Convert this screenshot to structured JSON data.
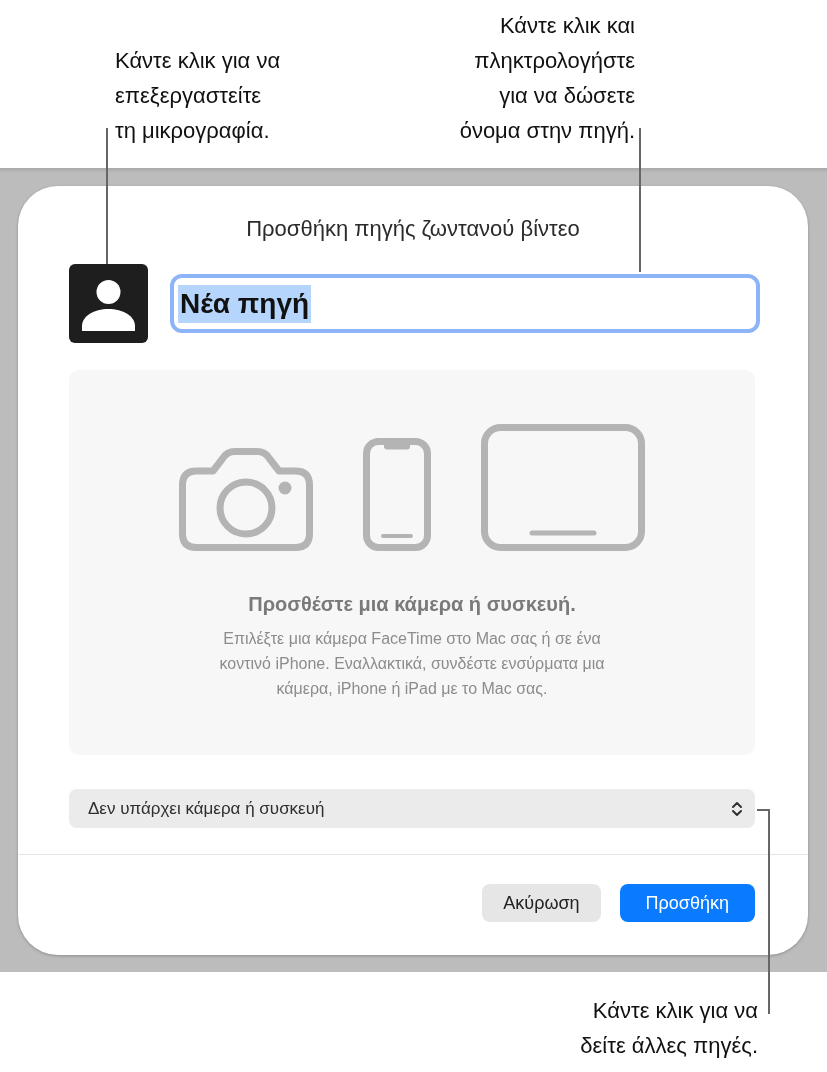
{
  "callouts": [
    {
      "lines": [
        "Κάντε κλικ για να",
        "επεξεργαστείτε",
        "τη μικρογραφία."
      ]
    },
    {
      "lines": [
        "Κάντε κλικ και",
        "πληκτρολογήστε",
        "για να δώσετε",
        "όνομα στην πηγή."
      ]
    },
    {
      "lines": [
        "Κάντε κλικ για να",
        "δείτε άλλες πηγές."
      ]
    }
  ],
  "dialog": {
    "title": "Προσθήκη πηγής ζωντανού βίντεο",
    "name_field": {
      "value": "Νέα πηγή",
      "focused": true,
      "text_selected": true
    },
    "empty_state": {
      "heading": "Προσθέστε μια κάμερα ή συσκευή.",
      "description_lines": [
        "Επιλέξτε μια κάμερα FaceTime στο Mac σας ή σε ένα",
        "κοντινό iPhone. Εναλλακτικά, συνδέστε ενσύρματα μια",
        "κάμερα, iPhone ή iPad με το Mac σας."
      ]
    },
    "source_popup": {
      "value": "Δεν υπάρχει κάμερα ή συσκευή"
    },
    "buttons": [
      {
        "label": "Ακύρωση",
        "kind": "secondary"
      },
      {
        "label": "Προσθήκη",
        "kind": "primary"
      }
    ]
  }
}
